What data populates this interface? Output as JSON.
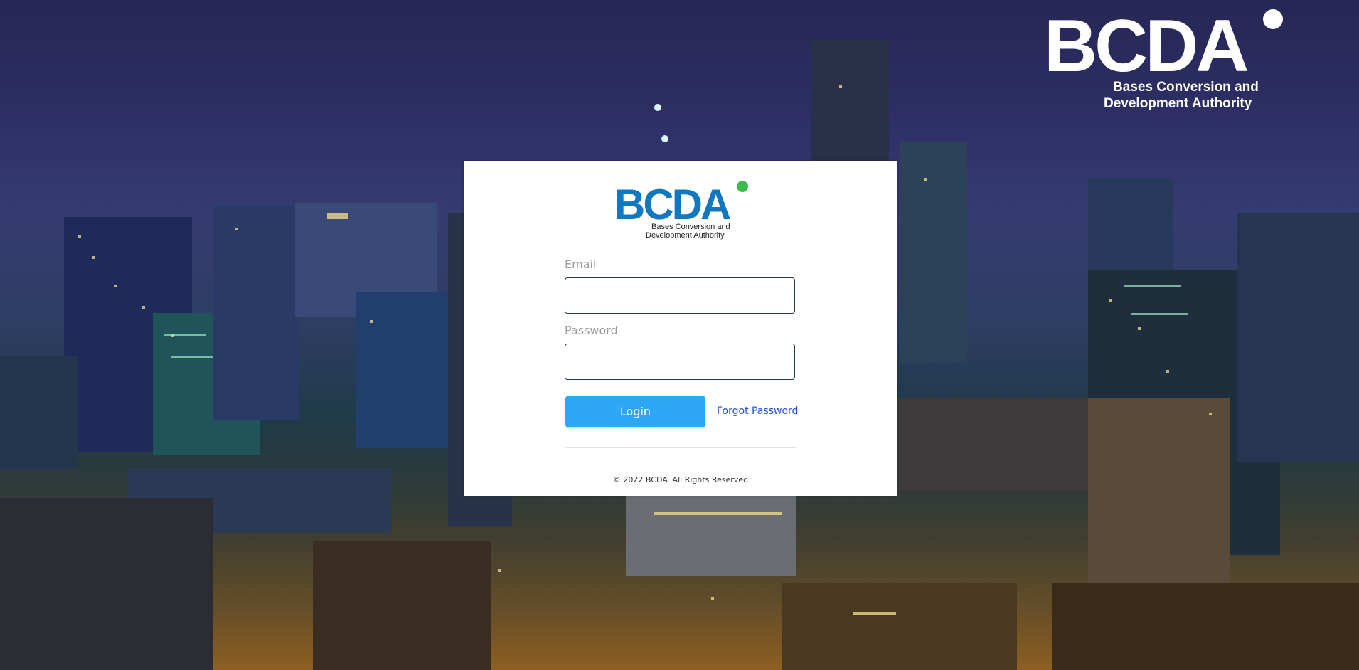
{
  "brand": {
    "name": "BCDA",
    "line1": "Bases Conversion and",
    "line2": "Development Authority",
    "colors": {
      "logo_blue": "#1277c1",
      "logo_green": "#3dbb4a",
      "corner_logo": "#ffffff"
    }
  },
  "form": {
    "email_label": "Email",
    "email_value": "",
    "password_label": "Password",
    "password_value": "",
    "login_label": "Login",
    "forgot_label": "Forgot Password",
    "colors": {
      "button": "#2ba7f5",
      "link": "#1b4fd8"
    }
  },
  "footer": {
    "copyright": "© 2022 BCDA. All Rights Reserved"
  },
  "background": {
    "description_icon": "night-city-skyline"
  }
}
